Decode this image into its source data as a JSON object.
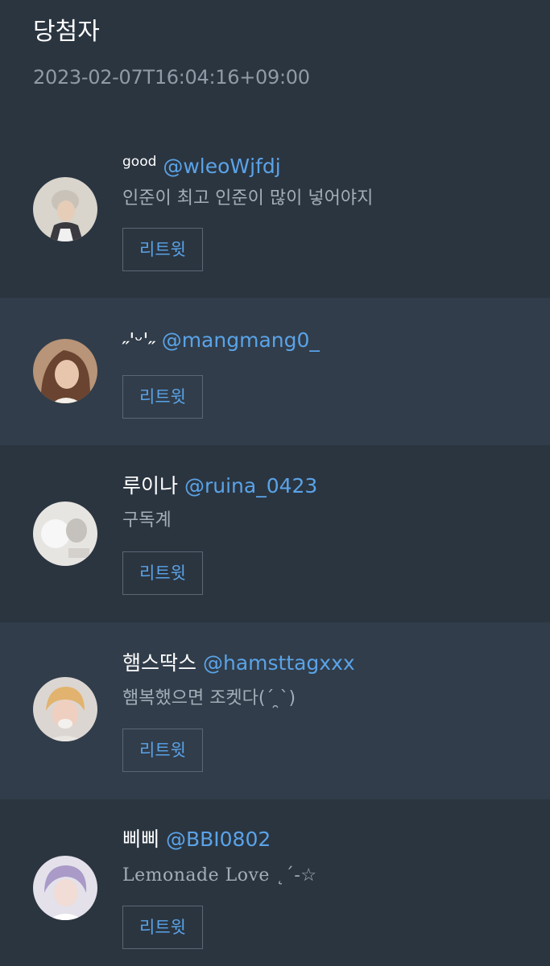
{
  "header": {
    "title": "당첨자",
    "timestamp": "2023-02-07T16:04:16+09:00"
  },
  "retweet_label": "리트윗",
  "winners": [
    {
      "nickname": "good",
      "handle": "@wleoWjfdj",
      "comment": "인준이 최고 인준이 많이 넣어야지",
      "avatar_icon": "avatar-photo-beanie"
    },
    {
      "nickname": "˶'ᵕ'˶",
      "handle": "@mangmang0_",
      "comment": "",
      "avatar_icon": "avatar-photo-long-hair"
    },
    {
      "nickname": "루이나",
      "handle": "@ruina_0423",
      "comment": "구독계",
      "avatar_icon": "avatar-photo-bright"
    },
    {
      "nickname": "햄스딱스",
      "handle": "@hamsttagxxx",
      "comment": "햄복했으면 조켓다(ˊ ̯ˋ)",
      "avatar_icon": "avatar-photo-blond"
    },
    {
      "nickname": "삐삐",
      "handle": "@BBI0802",
      "comment": "Lemonade Love ˛´-☆",
      "avatar_icon": "avatar-photo-lavender"
    }
  ]
}
